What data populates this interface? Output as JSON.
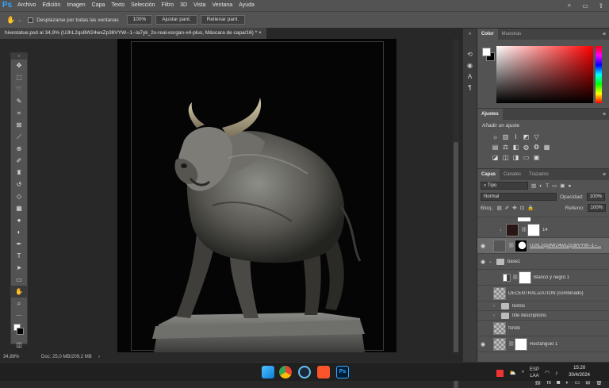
{
  "app": {
    "logo": "Ps"
  },
  "menu": [
    "Archivo",
    "Edición",
    "Imagen",
    "Capa",
    "Texto",
    "Selección",
    "Filtro",
    "3D",
    "Vista",
    "Ventana",
    "Ayuda"
  ],
  "menu_right_icons": [
    "search-icon",
    "workspace-icon",
    "share-icon"
  ],
  "options": {
    "scroll_all_label": "Desplazarse por todas las ventanas",
    "zoom_btn": "100%",
    "fit_btn": "Ajustar pant.",
    "fill_btn": "Rellenar pant."
  },
  "document_tab": "hivestatue.psd al 34,9% (UJhL2qs8W24wxZp38VYW--1--la7yk_2x-real-esrgan-x4-plus, Máscara de capa/16) * ×",
  "tools": [
    "move",
    "marquee",
    "lasso",
    "quick-select",
    "crop",
    "frame",
    "eyedropper",
    "healing",
    "brush",
    "clone",
    "history",
    "eraser",
    "gradient",
    "blur",
    "dodge",
    "pen",
    "text",
    "path-select",
    "shape",
    "hand",
    "zoom",
    "more"
  ],
  "status": {
    "zoom": "34,88%",
    "doc": "Doc: 25,0 MB/209,2 MB"
  },
  "color_panel": {
    "tabs": [
      "Color",
      "Muestras"
    ],
    "fg": "#ffffff",
    "bg": "#000000"
  },
  "adjustments_panel": {
    "tab": "Ajustes",
    "subtitle": "Añadir un ajuste"
  },
  "layers_panel": {
    "tabs": [
      "Capas",
      "Canales",
      "Trazados"
    ],
    "filter": "Tipo",
    "blend_mode": "Normal",
    "opacity_label": "Opacidad:",
    "opacity": "100%",
    "lock_label": "Bloq.:",
    "fill_label": "Relleno:",
    "fill": "100%",
    "layers": [
      {
        "name": "14",
        "visible": false,
        "thumb": "dark",
        "mask": true,
        "selected": false,
        "indent": 1
      },
      {
        "name": "UJhL2qs8W24wxZp38VYW--1--...",
        "visible": true,
        "thumb": "bull",
        "mask": true,
        "selected": true,
        "indent": 1
      },
      {
        "name": "base1",
        "visible": true,
        "folder": true,
        "expanded": true,
        "selected": false,
        "indent": 0
      },
      {
        "name": "Blanco y negro 1",
        "visible": false,
        "thumb": "white",
        "mask": true,
        "selected": false,
        "indent": 1
      },
      {
        "name": "DECENTRALIZATION (combinado)",
        "visible": false,
        "thumb": "checker",
        "selected": false,
        "indent": 0
      },
      {
        "name": "textos",
        "visible": false,
        "folder": true,
        "selected": false,
        "indent": 0
      },
      {
        "name": "title descriptions",
        "visible": false,
        "folder": true,
        "selected": false,
        "indent": 0
      },
      {
        "name": "fondo",
        "visible": false,
        "thumb": "checker",
        "selected": false,
        "indent": 0
      },
      {
        "name": "Rectángulo 1",
        "visible": true,
        "thumb": "checker",
        "mask": true,
        "selected": false,
        "indent": 0
      }
    ]
  },
  "taskbar": {
    "lang_top": "ESP",
    "lang_bottom": "LAA",
    "time": "15:20",
    "date": "30/4/2024"
  }
}
